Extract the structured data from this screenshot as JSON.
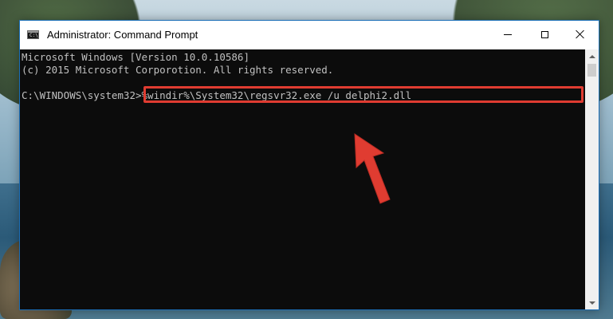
{
  "window": {
    "title": "Administrator: Command Prompt",
    "title_icon_text": "C:\\",
    "accent_color": "#1c6fb8"
  },
  "console": {
    "lines": [
      "Microsoft Windows [Version 10.0.10586]",
      "(c) 2015 Microsoft Corporotion. All rights reserved."
    ],
    "prompt": "C:\\WINDOWS\\system32>",
    "command": "%windir%\\System32\\regsvr32.exe /u delphi2.dll",
    "highlight_color": "#e03c31"
  },
  "icons": {
    "window_icon": "cmd-icon",
    "minimize": "minimize-icon",
    "maximize": "maximize-icon",
    "close": "close-icon",
    "annotation": "arrow-icon"
  }
}
